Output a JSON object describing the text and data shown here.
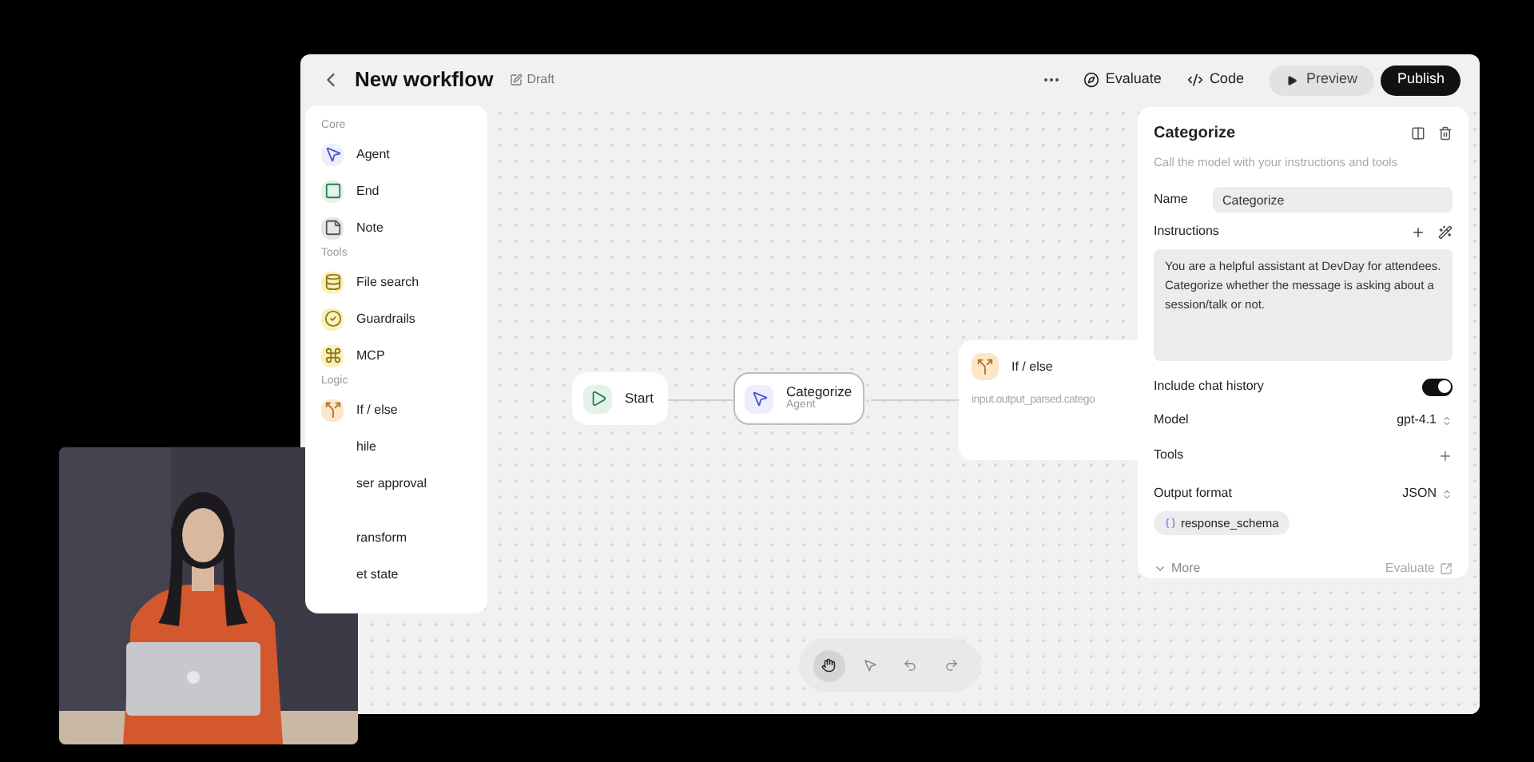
{
  "header": {
    "title": "New workflow",
    "badge": "Draft",
    "actions": [
      {
        "label": "Evaluate",
        "kind": "evaluate"
      },
      {
        "label": "Code",
        "kind": "code"
      }
    ],
    "preview": "Preview",
    "publish": "Publish"
  },
  "palette": {
    "sections": [
      {
        "label": "Core",
        "items": [
          {
            "label": "Agent",
            "kind": "agent"
          },
          {
            "label": "End",
            "kind": "end"
          },
          {
            "label": "Note",
            "kind": "note"
          }
        ]
      },
      {
        "label": "Tools",
        "items": [
          {
            "label": "File search",
            "kind": "file"
          },
          {
            "label": "Guardrails",
            "kind": "guard"
          },
          {
            "label": "MCP",
            "kind": "mcp"
          }
        ]
      },
      {
        "label": "Logic",
        "items": [
          {
            "label": "If / else",
            "kind": "ifelse"
          },
          {
            "label": "hile",
            "kind": "covered"
          },
          {
            "label": "ser approval",
            "kind": "covered"
          }
        ]
      },
      {
        "items": [
          {
            "label": "ransform",
            "kind": "covered"
          },
          {
            "label": "et state",
            "kind": "covered"
          }
        ]
      }
    ]
  },
  "nodes": [
    {
      "kind": "start",
      "title": "Start",
      "selected": false
    },
    {
      "kind": "agent",
      "title": "Categorize",
      "subtitle": "Agent",
      "selected": true
    },
    {
      "kind": "ifelse",
      "title": "If / else",
      "condition": "input.output_parsed.catego",
      "selected": false
    }
  ],
  "inspector": {
    "title": "Categorize",
    "description": "Call the model with your instructions and tools",
    "name_label": "Name",
    "name_value": "Categorize",
    "instructions_label": "Instructions",
    "instructions": "You are a helpful assistant at DevDay for attendees. Categorize whether the message is asking about a session/talk or not.",
    "chat_history": {
      "label": "Include chat history",
      "on": true
    },
    "model": {
      "label": "Model",
      "value": "gpt-4.1"
    },
    "tools_label": "Tools",
    "output": {
      "label": "Output format",
      "value": "JSON"
    },
    "schema_chip": "response_schema",
    "more": "More",
    "evaluate": "Evaluate"
  },
  "toolbar": [
    {
      "kind": "hand",
      "selected": true
    },
    {
      "kind": "pointer",
      "selected": false
    },
    {
      "kind": "undo",
      "selected": false
    },
    {
      "kind": "redo",
      "selected": false
    }
  ]
}
